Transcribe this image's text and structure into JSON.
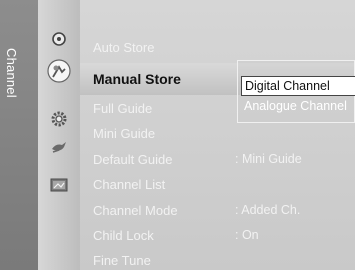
{
  "sidebar": {
    "title": "Channel"
  },
  "icons": [
    {
      "name": "input-icon"
    },
    {
      "name": "channel-icon"
    },
    {
      "name": "setup-icon"
    },
    {
      "name": "application-icon"
    },
    {
      "name": "picture-icon"
    }
  ],
  "menu": {
    "items": [
      {
        "label": "Auto Store",
        "value": ""
      },
      {
        "label": "Manual Store",
        "value": ""
      },
      {
        "label": "Full Guide",
        "value": ""
      },
      {
        "label": "Mini Guide",
        "value": ""
      },
      {
        "label": "Default Guide",
        "value": ": Mini Guide"
      },
      {
        "label": "Channel List",
        "value": ""
      },
      {
        "label": "Channel Mode",
        "value": ": Added Ch."
      },
      {
        "label": "Child Lock",
        "value": ": On"
      },
      {
        "label": "Fine Tune",
        "value": ""
      }
    ]
  },
  "popup": {
    "options": [
      "Digital Channel",
      "Analogue Channel"
    ]
  },
  "colors": {
    "sidebar": "#808080",
    "menu_bg": "#d0d0d0",
    "highlight_text": "#111111"
  }
}
